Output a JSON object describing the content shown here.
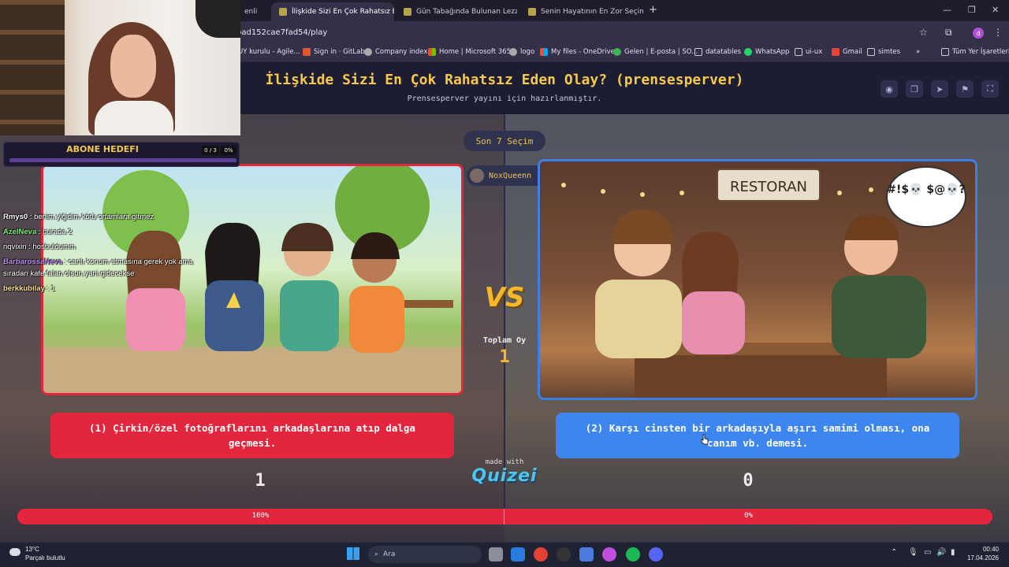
{
  "browser": {
    "tabs": [
      {
        "label": "enli",
        "active": false
      },
      {
        "label": "İlişkide Sizi En Çok Rahatsız Ede",
        "active": true
      },
      {
        "label": "Gün Tabağında Bulunan Lezzetli",
        "active": false
      },
      {
        "label": "Senin Hayatının En Zor Seçimi",
        "active": false
      }
    ],
    "new_tab": "+",
    "url": "bad152cae7fad54/play",
    "bookmarks": [
      "UY kurulu - Agile...",
      "Sign in · GitLab",
      "Company index",
      "Home | Microsoft 365",
      "logo",
      "My files - OneDrive",
      "Gelen | E-posta | SO...",
      "datatables",
      "WhatsApp",
      "ui-ux",
      "Gmail",
      "simtes",
      "»",
      "Tüm Yer İşaretleri"
    ],
    "profile_initial": "d"
  },
  "quiz": {
    "title": "İlişkide Sizi En Çok Rahatsız Eden Olay? (prensesperver)",
    "subtitle": "Prensesperver yayını için hazırlanmıştır.",
    "last_label": "Son 7 Seçim",
    "voter_name": "NoxQueenn",
    "vs_label": "VS",
    "total_label": "Toplam Oy",
    "total_value": "1",
    "option_left": "(1) Çirkin/özel fotoğraflarını arkadaşlarına atıp dalga geçmesi.",
    "option_right": "(2) Karşı cinsten bir arkadaşıyla aşırı samimi olması, ona canım vb. demesi.",
    "score_left": "1",
    "score_right": "0",
    "percent_left_text": "100%",
    "percent_right_text": "0%",
    "percent_left": 100,
    "made_with": "made with",
    "brand": "Quizei",
    "restaurant_sign": "RESTORAN",
    "speech_bubble": "#!$💀 $@💀?"
  },
  "overlay": {
    "goal_title": "ABONE HEDEFI",
    "goal_count": "0 / 3",
    "goal_pct": "0%",
    "chat": [
      {
        "user": "Rmys0",
        "msg": ": benim yiğidim kötü ortamlara gitmez",
        "color": "#ffffff"
      },
      {
        "user": "AzelNeva",
        "msg": ": burada 2",
        "color": "#7cf07c"
      },
      {
        "user": "nqvixin",
        "msg": ": hosbuldumm",
        "color": "#ffffff"
      },
      {
        "user": "BarbarossaNeva",
        "msg": ": canlı konum atmasına gerek yok ama",
        "color": "#c58af9"
      },
      {
        "user": "",
        "msg": "sıradan kafe falan olsun yani gidecekse",
        "color": "#ffffff"
      },
      {
        "user": "berkkubilay",
        "msg": ": 1",
        "color": "#ffe08a"
      }
    ]
  },
  "taskbar": {
    "weather_temp": "13°C",
    "weather_desc": "Parçalı bulutlu",
    "search_placeholder": "Ara",
    "time": "00:40",
    "date": "17.04.2026"
  },
  "colors": {
    "red": "#e3263d",
    "blue": "#3e86ef",
    "gold": "#f5b82b"
  }
}
